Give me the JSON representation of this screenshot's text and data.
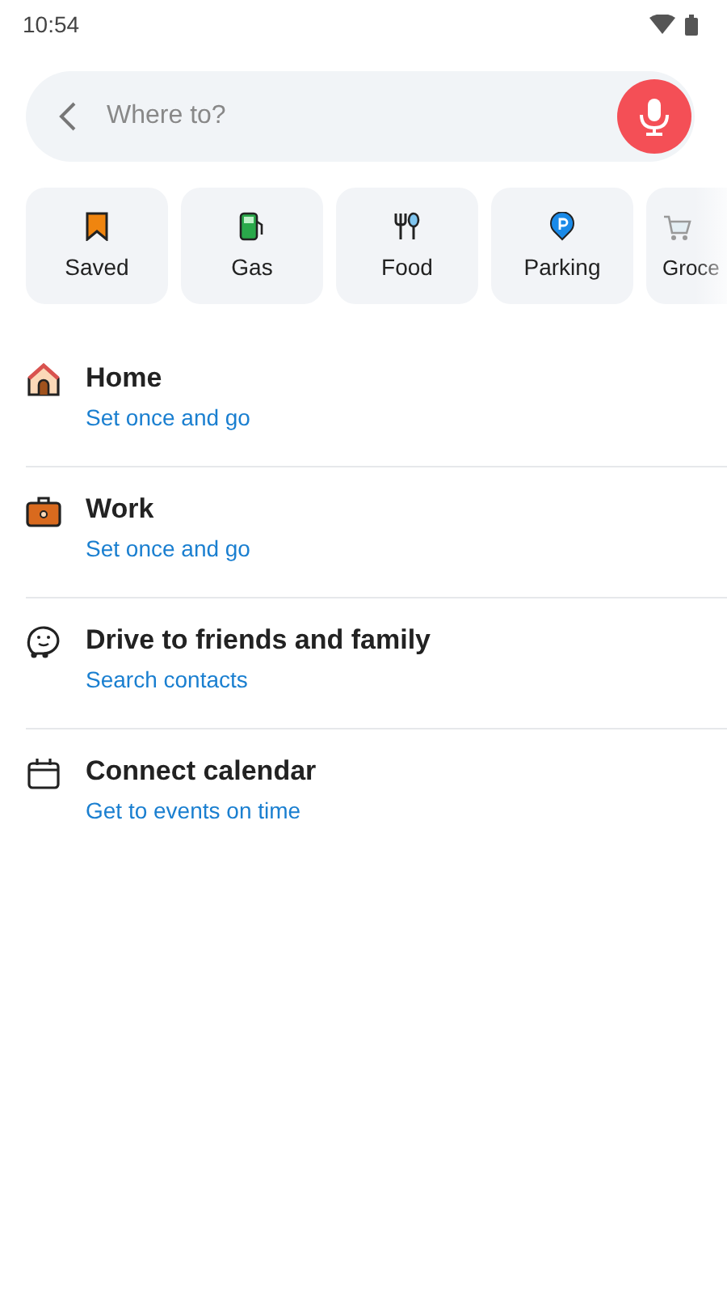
{
  "status_bar": {
    "time": "10:54"
  },
  "search": {
    "placeholder": "Where to?"
  },
  "categories": [
    {
      "kind": "saved",
      "label": "Saved"
    },
    {
      "kind": "gas",
      "label": "Gas"
    },
    {
      "kind": "food",
      "label": "Food"
    },
    {
      "kind": "parking",
      "label": "Parking"
    },
    {
      "kind": "grocery",
      "label": "Groce"
    }
  ],
  "places": [
    {
      "kind": "home",
      "title": "Home",
      "subtitle": "Set once and go"
    },
    {
      "kind": "work",
      "title": "Work",
      "subtitle": "Set once and go"
    },
    {
      "kind": "friends",
      "title": "Drive to friends and family",
      "subtitle": "Search contacts"
    },
    {
      "kind": "calendar",
      "title": "Connect calendar",
      "subtitle": "Get to events on time"
    }
  ]
}
